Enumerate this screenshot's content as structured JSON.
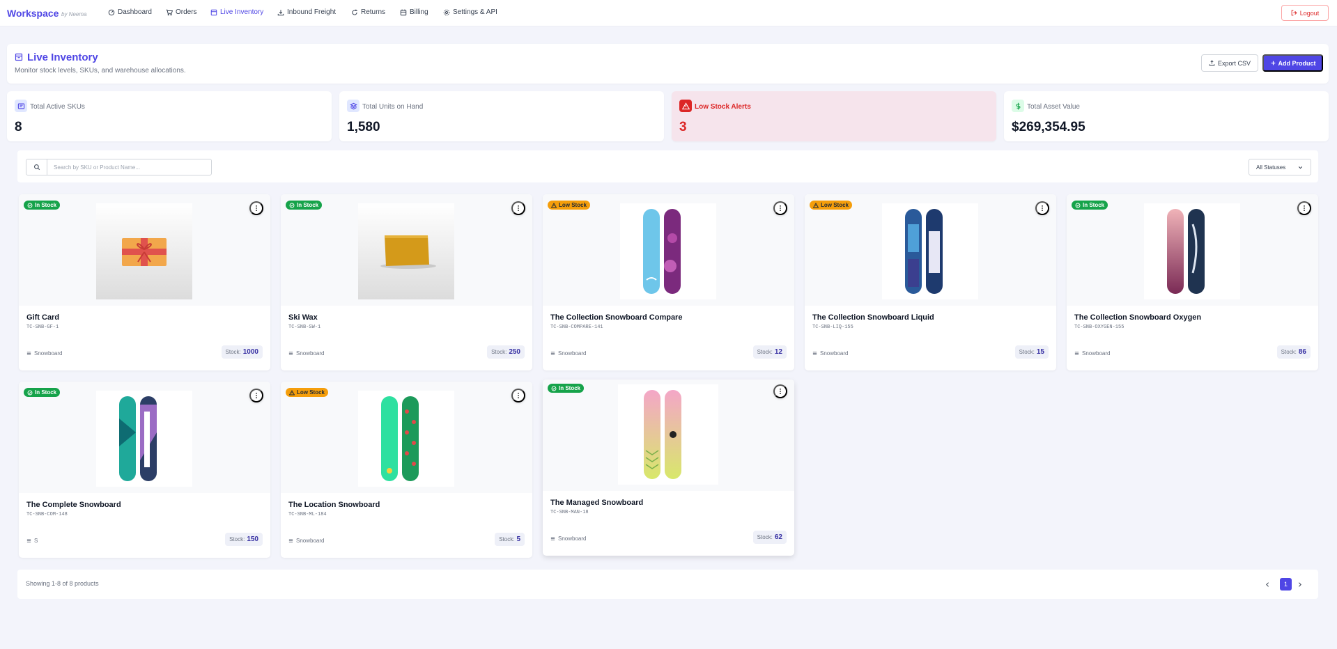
{
  "app": {
    "brand": "Workspace",
    "brand_by": "by Neema"
  },
  "nav": {
    "items": [
      {
        "label": "Dashboard",
        "icon": "gauge-icon"
      },
      {
        "label": "Orders",
        "icon": "cart-icon"
      },
      {
        "label": "Live Inventory",
        "icon": "box-icon",
        "active": true
      },
      {
        "label": "Inbound Freight",
        "icon": "download-icon"
      },
      {
        "label": "Returns",
        "icon": "refresh-icon"
      },
      {
        "label": "Billing",
        "icon": "calendar-icon"
      },
      {
        "label": "Settings & API",
        "icon": "gear-icon"
      }
    ],
    "logout": "Logout"
  },
  "header": {
    "title": "Live Inventory",
    "subtitle": "Monitor stock levels, SKUs, and warehouse allocations.",
    "export_label": "Export CSV",
    "add_label": "Add Product"
  },
  "stats": [
    {
      "label": "Total Active SKUs",
      "value": "8",
      "icon": "list-icon"
    },
    {
      "label": "Total Units on Hand",
      "value": "1,580",
      "icon": "layers-icon"
    },
    {
      "label": "Low Stock Alerts",
      "value": "3",
      "icon": "warning-icon"
    },
    {
      "label": "Total Asset Value",
      "value": "$269,354.95",
      "icon": "dollar-icon"
    }
  ],
  "filters": {
    "search_placeholder": "Search by SKU or Product Name...",
    "status_value": "All Statuses"
  },
  "stock_prefix": "Stock:",
  "products": [
    {
      "name": "Gift Card",
      "sku": "TC-SNB-GF-1",
      "category": "Snowboard",
      "stock": "1000",
      "status": "In Stock",
      "image": "gift-card"
    },
    {
      "name": "Ski Wax",
      "sku": "TC-SNB-SW-1",
      "category": "Snowboard",
      "stock": "250",
      "status": "In Stock",
      "image": "ski-wax"
    },
    {
      "name": "The Collection Snowboard Compare",
      "sku": "TC-SNB-COMPARE-141",
      "category": "Snowboard",
      "stock": "12",
      "status": "Low Stock",
      "image": "board-compare"
    },
    {
      "name": "The Collection Snowboard Liquid",
      "sku": "TC-SNB-LIQ-155",
      "category": "Snowboard",
      "stock": "15",
      "status": "Low Stock",
      "image": "board-liquid"
    },
    {
      "name": "The Collection Snowboard Oxygen",
      "sku": "TC-SNB-OXYGEN-155",
      "category": "Snowboard",
      "stock": "86",
      "status": "In Stock",
      "image": "board-oxygen"
    },
    {
      "name": "The Complete Snowboard",
      "sku": "TC-SNB-COM-148",
      "category": "S",
      "stock": "150",
      "status": "In Stock",
      "image": "board-complete"
    },
    {
      "name": "The Location Snowboard",
      "sku": "TC-SNB-ML-184",
      "category": "Snowboard",
      "stock": "5",
      "status": "Low Stock",
      "image": "board-location"
    },
    {
      "name": "The Managed Snowboard",
      "sku": "TC-SNB-MAN-18",
      "category": "Snowboard",
      "stock": "62",
      "status": "In Stock",
      "image": "board-managed"
    }
  ],
  "footer": {
    "showing": "Showing 1-8 of 8 products",
    "page": "1"
  },
  "colors": {
    "accent": "#4f46e5",
    "in_stock": "#16a34a",
    "low_stock": "#f59e0b",
    "alert": "#dc2626"
  }
}
